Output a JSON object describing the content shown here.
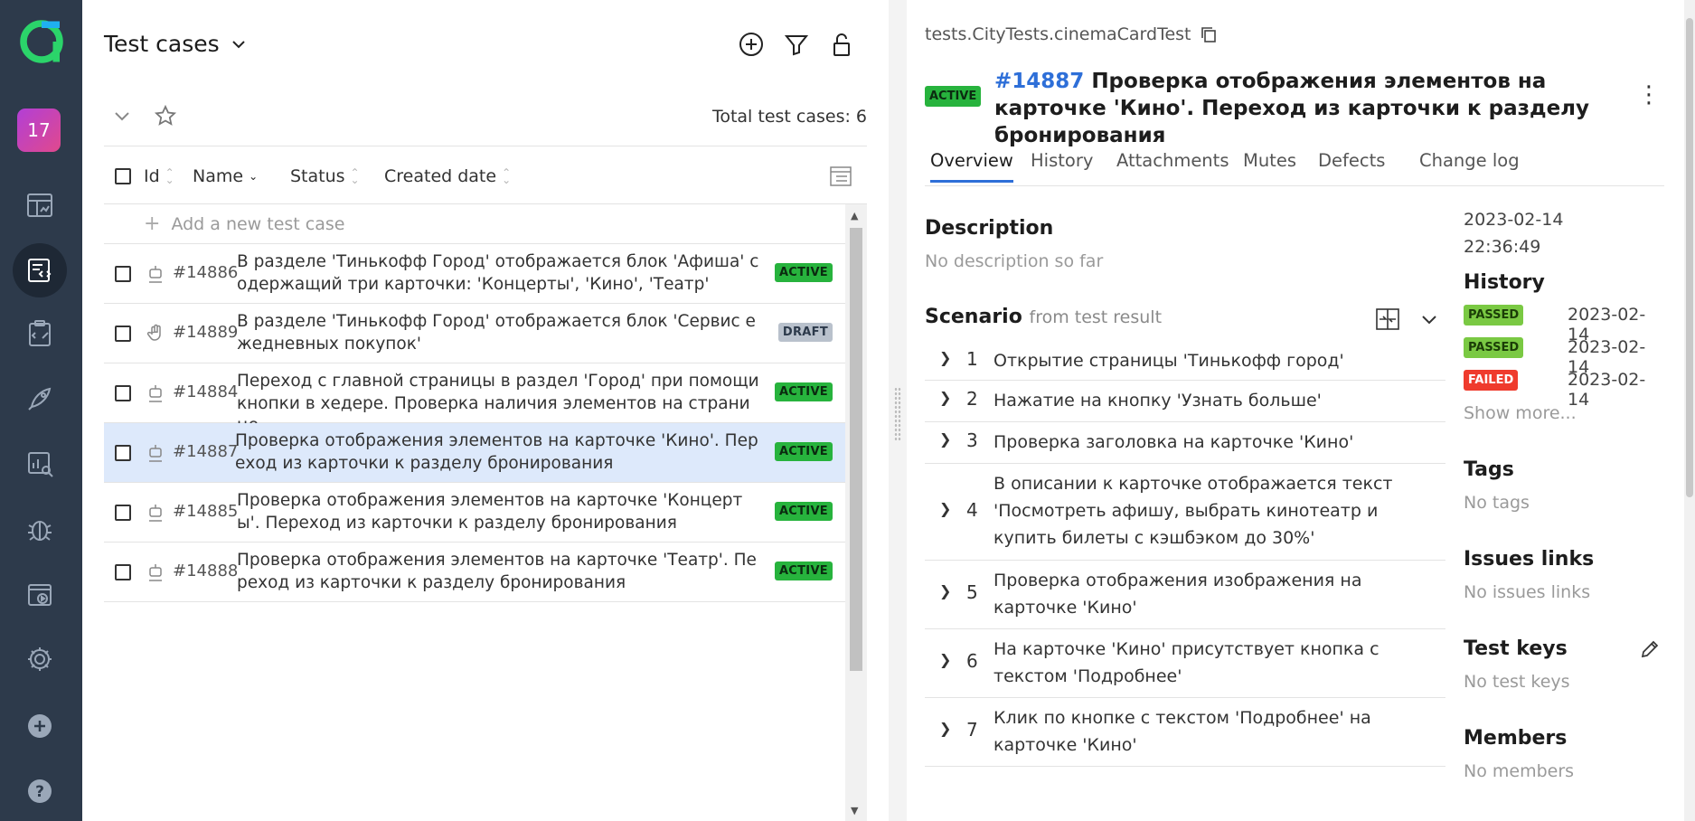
{
  "rail": {
    "project_number": "17",
    "items": [
      {
        "icon": "allure-logo-icon"
      },
      {
        "icon": "dashboard-icon"
      },
      {
        "icon": "test-cases-icon"
      },
      {
        "icon": "test-plans-icon"
      },
      {
        "icon": "launches-icon"
      },
      {
        "icon": "analytics-icon"
      },
      {
        "icon": "defects-icon"
      },
      {
        "icon": "jobs-icon"
      },
      {
        "icon": "settings-icon"
      },
      {
        "icon": "add-icon"
      },
      {
        "icon": "help-icon"
      }
    ]
  },
  "list": {
    "title": "Test cases",
    "total_label": "Total test cases: 6",
    "columns": {
      "id": "Id",
      "name": "Name",
      "status": "Status",
      "created": "Created date"
    },
    "add_placeholder": "Add a new test case",
    "rows": [
      {
        "id": "#14886",
        "name": "В разделе 'Тинькофф Город' отображается блок 'Афиша' содержащий три карточки: 'Концерты', 'Кино', 'Театр'",
        "status": "ACTIVE"
      },
      {
        "id": "#14889",
        "name": "В разделе 'Тинькофф Город' отображается блок 'Сервис ежедневных покупок'",
        "status": "DRAFT"
      },
      {
        "id": "#14884",
        "name": "Переход с главной страницы в раздел 'Город' при помощи кнопки в хедере. Проверка наличия элементов на странице",
        "status": "ACTIVE"
      },
      {
        "id": "#14887",
        "name": "Проверка отображения элементов на карточке 'Кино'. Переход из карточки к разделу бронирования",
        "status": "ACTIVE"
      },
      {
        "id": "#14885",
        "name": "Проверка отображения элементов на карточке 'Концерты'. Переход из карточки к разделу бронирования",
        "status": "ACTIVE"
      },
      {
        "id": "#14888",
        "name": "Проверка отображения элементов на карточке 'Театр'. Переход из карточки к разделу бронирования",
        "status": "ACTIVE"
      }
    ]
  },
  "detail": {
    "path": "tests.CityTests.cinemaCardTest",
    "status": "ACTIVE",
    "number": "#14887",
    "title": "Проверка отображения элементов на карточке 'Кино'. Переход из карточки к разделу бронирования",
    "tabs": [
      "Overview",
      "History",
      "Attachments",
      "Mutes",
      "Defects",
      "Change log"
    ],
    "description_heading": "Description",
    "description_text": "No description so far",
    "scenario_heading": "Scenario",
    "scenario_sub": "from test result",
    "steps": [
      {
        "n": "1",
        "text": "Открытие страницы 'Тинькофф город'"
      },
      {
        "n": "2",
        "text": "Нажатие на кнопку 'Узнать больше'"
      },
      {
        "n": "3",
        "text": "Проверка заголовка на карточке 'Кино'"
      },
      {
        "n": "4",
        "text": "В описании к карточке отображается текст 'Посмотреть афишу, выбрать кинотеатр и купить билеты с кэшбэком до 30%'"
      },
      {
        "n": "5",
        "text": "Проверка отображения изображения на карточке 'Кино'"
      },
      {
        "n": "6",
        "text": "На карточке 'Кино' присутствует кнопка с текстом 'Подробнее'"
      },
      {
        "n": "7",
        "text": "Клик по кнопке с текстом 'Подробнее' на карточке 'Кино'"
      }
    ],
    "created_date": "2023-02-14",
    "created_time": "22:36:49",
    "history_heading": "History",
    "history": [
      {
        "status": "PASSED",
        "date": "2023-02-14"
      },
      {
        "status": "PASSED",
        "date": "2023-02-14"
      },
      {
        "status": "FAILED",
        "date": "2023-02-14"
      }
    ],
    "show_more": "Show more...",
    "tags_heading": "Tags",
    "tags_empty": "No tags",
    "issues_heading": "Issues links",
    "issues_empty": "No issues links",
    "keys_heading": "Test keys",
    "keys_empty": "No test keys",
    "members_heading": "Members",
    "members_empty": "No members"
  },
  "colors": {
    "rail": "#2d3a4b",
    "accent": "#2e6fd8",
    "active": "#27b33d",
    "passed": "#7ac943",
    "failed": "#ef3b2d",
    "selected_row": "#dde9fb"
  }
}
